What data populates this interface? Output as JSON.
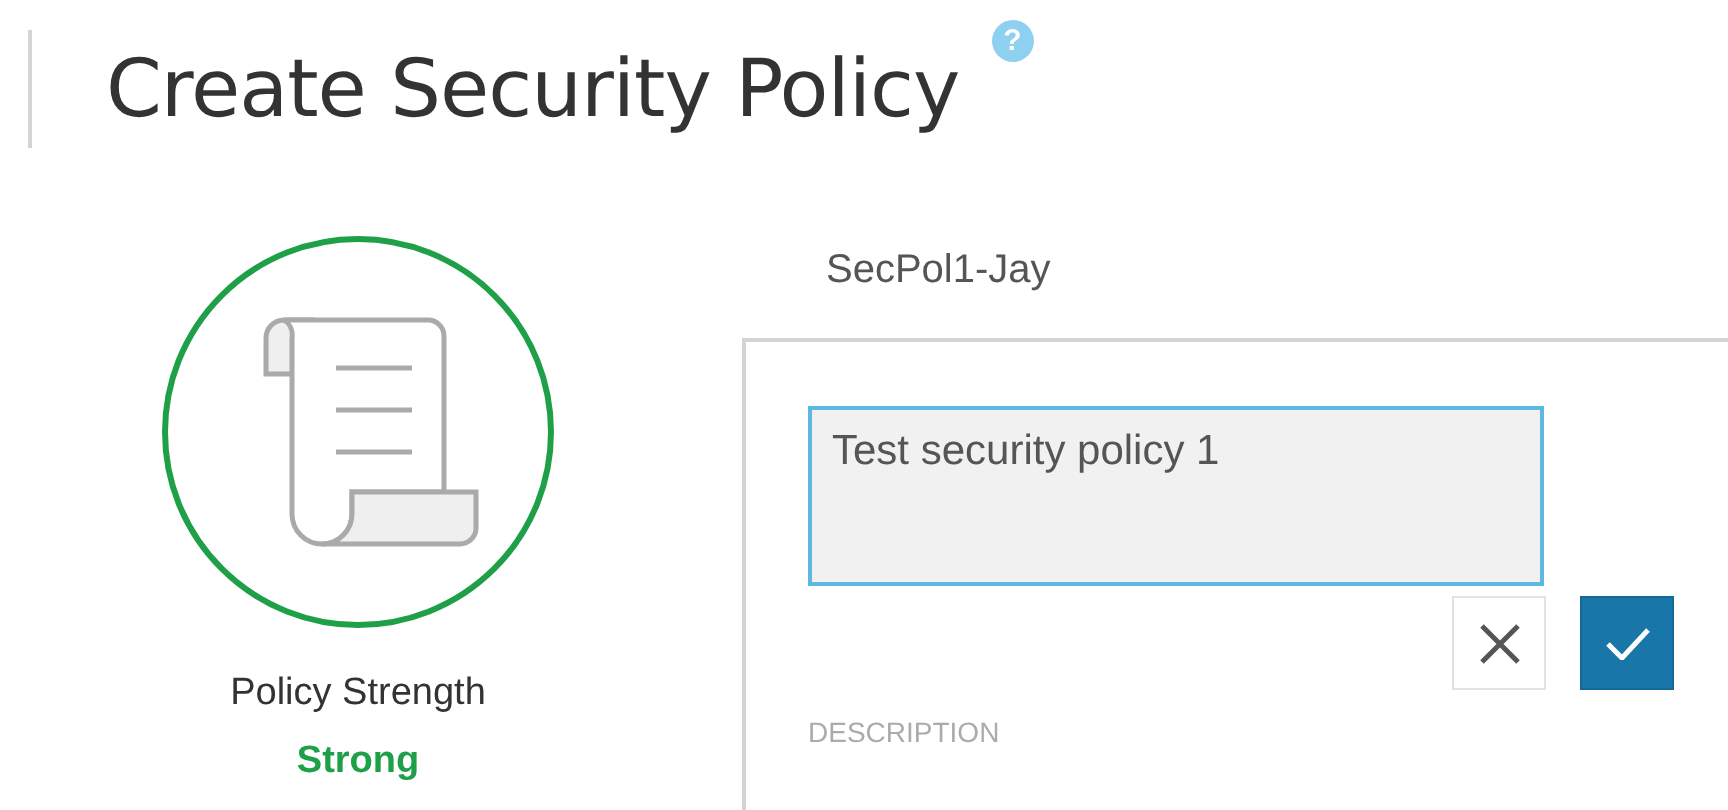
{
  "header": {
    "title": "Create Security Policy",
    "help": "?"
  },
  "strength": {
    "label": "Policy Strength",
    "value": "Strong",
    "color": "#1fa048"
  },
  "policy": {
    "name": "SecPol1-Jay",
    "description": {
      "value": "Test security policy 1",
      "label": "DESCRIPTION"
    },
    "buttons": [
      {
        "kind": "cancel"
      },
      {
        "kind": "confirm"
      }
    ]
  }
}
